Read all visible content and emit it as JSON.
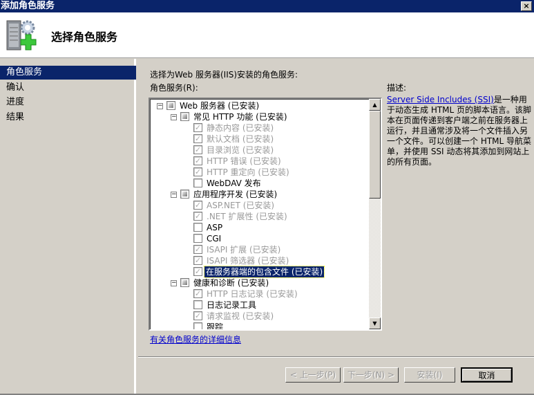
{
  "window": {
    "title": "添加角色服务",
    "close": "×"
  },
  "header": {
    "title": "选择角色服务",
    "icon": "server-gear-plus-icon"
  },
  "nav": {
    "items": [
      {
        "label": "角色服务",
        "selected": true
      },
      {
        "label": "确认"
      },
      {
        "label": "进度"
      },
      {
        "label": "结果"
      }
    ]
  },
  "main": {
    "intro": "选择为Web 服务器(IIS)安装的角色服务:",
    "role_label": "角色服务(R):",
    "tree": [
      {
        "level": 0,
        "label": "Web 服务器  (已安装)",
        "state": "partial",
        "expander": "−",
        "disabled": false
      },
      {
        "level": 1,
        "label": "常见 HTTP 功能  (已安装)",
        "state": "partial",
        "expander": "−",
        "disabled": false
      },
      {
        "level": 2,
        "label": "静态内容  (已安装)",
        "state": "checked",
        "disabled": true
      },
      {
        "level": 2,
        "label": "默认文档  (已安装)",
        "state": "checked",
        "disabled": true
      },
      {
        "level": 2,
        "label": "目录浏览  (已安装)",
        "state": "checked",
        "disabled": true
      },
      {
        "level": 2,
        "label": "HTTP 错误  (已安装)",
        "state": "checked",
        "disabled": true
      },
      {
        "level": 2,
        "label": "HTTP 重定向  (已安装)",
        "state": "checked",
        "disabled": true
      },
      {
        "level": 2,
        "label": "WebDAV 发布",
        "state": "unchecked",
        "disabled": false
      },
      {
        "level": 1,
        "label": "应用程序开发  (已安装)",
        "state": "partial",
        "expander": "−",
        "disabled": false
      },
      {
        "level": 2,
        "label": "ASP.NET  (已安装)",
        "state": "checked",
        "disabled": true
      },
      {
        "level": 2,
        "label": ".NET 扩展性  (已安装)",
        "state": "checked",
        "disabled": true
      },
      {
        "level": 2,
        "label": "ASP",
        "state": "unchecked",
        "disabled": false
      },
      {
        "level": 2,
        "label": "CGI",
        "state": "unchecked",
        "disabled": false
      },
      {
        "level": 2,
        "label": "ISAPI 扩展  (已安装)",
        "state": "checked",
        "disabled": true
      },
      {
        "level": 2,
        "label": "ISAPI 筛选器  (已安装)",
        "state": "checked",
        "disabled": true
      },
      {
        "level": 2,
        "label": "在服务器端的包含文件  (已安装)",
        "state": "checked",
        "disabled": true,
        "selected": true
      },
      {
        "level": 1,
        "label": "健康和诊断  (已安装)",
        "state": "partial",
        "expander": "−",
        "disabled": false
      },
      {
        "level": 2,
        "label": "HTTP 日志记录  (已安装)",
        "state": "checked",
        "disabled": true
      },
      {
        "level": 2,
        "label": "日志记录工具",
        "state": "unchecked",
        "disabled": false
      },
      {
        "level": 2,
        "label": "请求监视  (已安装)",
        "state": "checked",
        "disabled": true
      },
      {
        "level": 2,
        "label": "跟踪",
        "state": "unchecked",
        "disabled": false
      }
    ],
    "more_link": "有关角色服务的详细信息",
    "description": {
      "label": "描述:",
      "link": "Server Side Includes (SSI)",
      "text": "是一种用于动态生成 HTML 页的脚本语言。该脚本在页面传递到客户端之前在服务器上运行，并且通常涉及将一个文件插入另一个文件。可以创建一个 HTML 导航菜单，并使用 SSI 动态将其添加到网站上的所有页面。"
    }
  },
  "buttons": {
    "prev": "< 上一步(P)",
    "next": "下一步(N) >",
    "install": "安装(I)",
    "cancel": "取消"
  }
}
